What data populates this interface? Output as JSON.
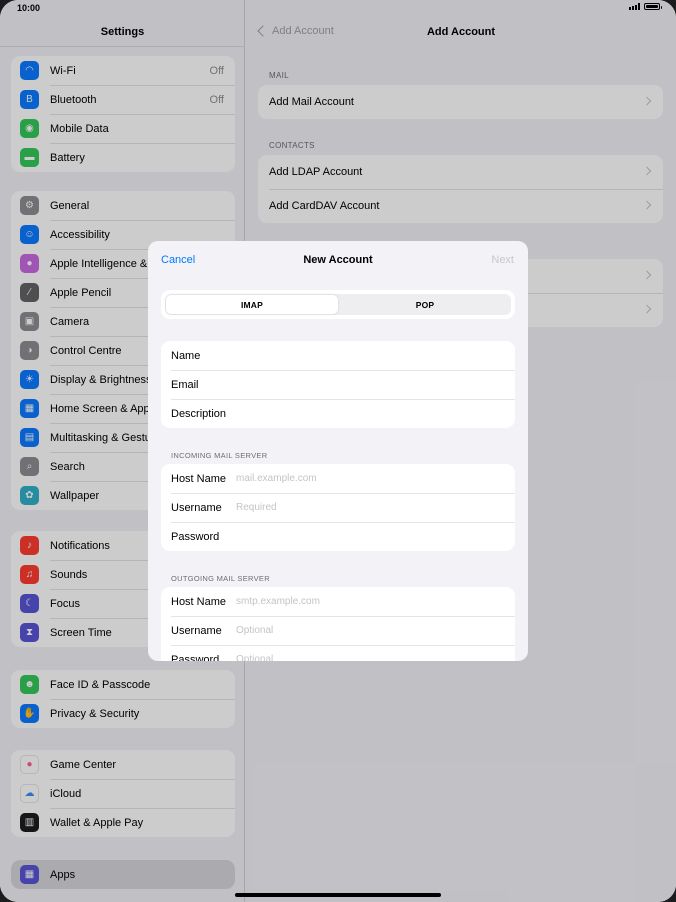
{
  "status": {
    "time": "10:00"
  },
  "sidebar": {
    "title": "Settings",
    "groups": [
      [
        {
          "label": "Wi-Fi",
          "value": "Off",
          "icon": "wifi-icon",
          "color": "#0a7aff"
        },
        {
          "label": "Bluetooth",
          "value": "Off",
          "icon": "bluetooth-icon",
          "color": "#0a7aff"
        },
        {
          "label": "Mobile Data",
          "icon": "antenna-icon",
          "color": "#34c759"
        },
        {
          "label": "Battery",
          "icon": "battery-icon",
          "color": "#34c759"
        }
      ],
      [
        {
          "label": "General",
          "icon": "gear-icon",
          "color": "#8e8e93"
        },
        {
          "label": "Accessibility",
          "icon": "accessibility-icon",
          "color": "#0a7aff"
        },
        {
          "label": "Apple Intelligence & Siri",
          "icon": "siri-icon",
          "color": "#c969e0"
        },
        {
          "label": "Apple Pencil",
          "icon": "pencil-icon",
          "color": "#636366"
        },
        {
          "label": "Camera",
          "icon": "camera-icon",
          "color": "#8e8e93"
        },
        {
          "label": "Control Centre",
          "icon": "toggles-icon",
          "color": "#8e8e93"
        },
        {
          "label": "Display & Brightness",
          "icon": "sun-icon",
          "color": "#0a7aff"
        },
        {
          "label": "Home Screen & App Library",
          "icon": "home-screen-icon",
          "color": "#0a7aff"
        },
        {
          "label": "Multitasking & Gestures",
          "icon": "multitasking-icon",
          "color": "#0a7aff"
        },
        {
          "label": "Search",
          "icon": "search-icon",
          "color": "#8e8e93"
        },
        {
          "label": "Wallpaper",
          "icon": "wallpaper-icon",
          "color": "#30b0c7"
        }
      ],
      [
        {
          "label": "Notifications",
          "icon": "bell-icon",
          "color": "#ff3b30"
        },
        {
          "label": "Sounds",
          "icon": "speaker-icon",
          "color": "#ff3b30"
        },
        {
          "label": "Focus",
          "icon": "moon-icon",
          "color": "#5856d6"
        },
        {
          "label": "Screen Time",
          "icon": "hourglass-icon",
          "color": "#5856d6"
        }
      ],
      [
        {
          "label": "Face ID & Passcode",
          "icon": "face-id-icon",
          "color": "#34c759"
        },
        {
          "label": "Privacy & Security",
          "icon": "hand-icon",
          "color": "#0a7aff"
        }
      ],
      [
        {
          "label": "Game Center",
          "icon": "game-center-icon",
          "color": "#ffffff"
        },
        {
          "label": "iCloud",
          "icon": "cloud-icon",
          "color": "#ffffff"
        },
        {
          "label": "Wallet & Apple Pay",
          "icon": "wallet-icon",
          "color": "#1c1c1e"
        }
      ],
      [
        {
          "label": "Apps",
          "icon": "apps-icon",
          "color": "#5856d6",
          "selected": true
        }
      ]
    ]
  },
  "detail": {
    "back_label": "Add Account",
    "title": "Add Account",
    "mail_section": "MAIL",
    "add_mail": "Add Mail Account",
    "contacts_section": "CONTACTS",
    "add_ldap": "Add LDAP Account",
    "add_carddav": "Add CardDAV Account"
  },
  "modal": {
    "cancel": "Cancel",
    "title": "New Account",
    "next": "Next",
    "segments": [
      "IMAP",
      "POP"
    ],
    "fields_top": [
      {
        "label": "Name"
      },
      {
        "label": "Email"
      },
      {
        "label": "Description"
      }
    ],
    "incoming_section": "INCOMING MAIL SERVER",
    "incoming": [
      {
        "label": "Host Name",
        "placeholder": "mail.example.com"
      },
      {
        "label": "Username",
        "placeholder": "Required"
      },
      {
        "label": "Password",
        "placeholder": ""
      }
    ],
    "outgoing_section": "OUTGOING MAIL SERVER",
    "outgoing": [
      {
        "label": "Host Name",
        "placeholder": "smtp.example.com"
      },
      {
        "label": "Username",
        "placeholder": "Optional"
      },
      {
        "label": "Password",
        "placeholder": "Optional"
      }
    ]
  }
}
